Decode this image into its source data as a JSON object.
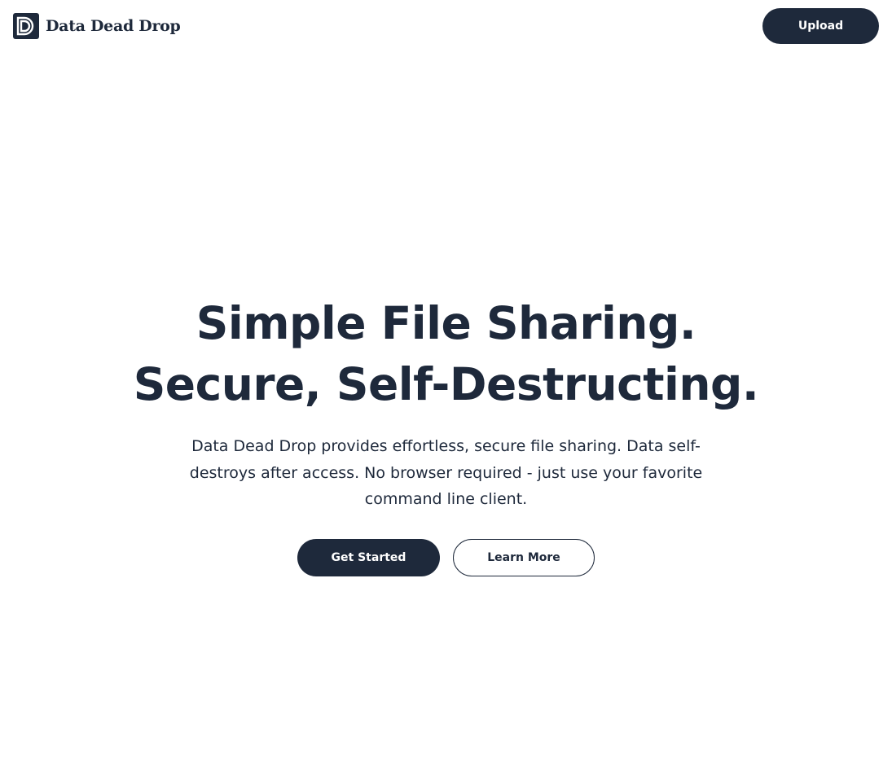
{
  "header": {
    "brand_name": "Data Dead Drop",
    "logo_icon": "dd-logo-icon",
    "upload_label": "Upload"
  },
  "hero": {
    "title_line1": "Simple File Sharing.",
    "title_line2": "Secure, Self-Destructing.",
    "description": "Data Dead Drop provides effortless, secure file sharing. Data self-destroys after access. No browser required - just use your favorite command line client.",
    "primary_cta": "Get Started",
    "secondary_cta": "Learn More"
  },
  "colors": {
    "primary": "#1e293b",
    "background": "#ffffff",
    "text": "#1e293b"
  }
}
